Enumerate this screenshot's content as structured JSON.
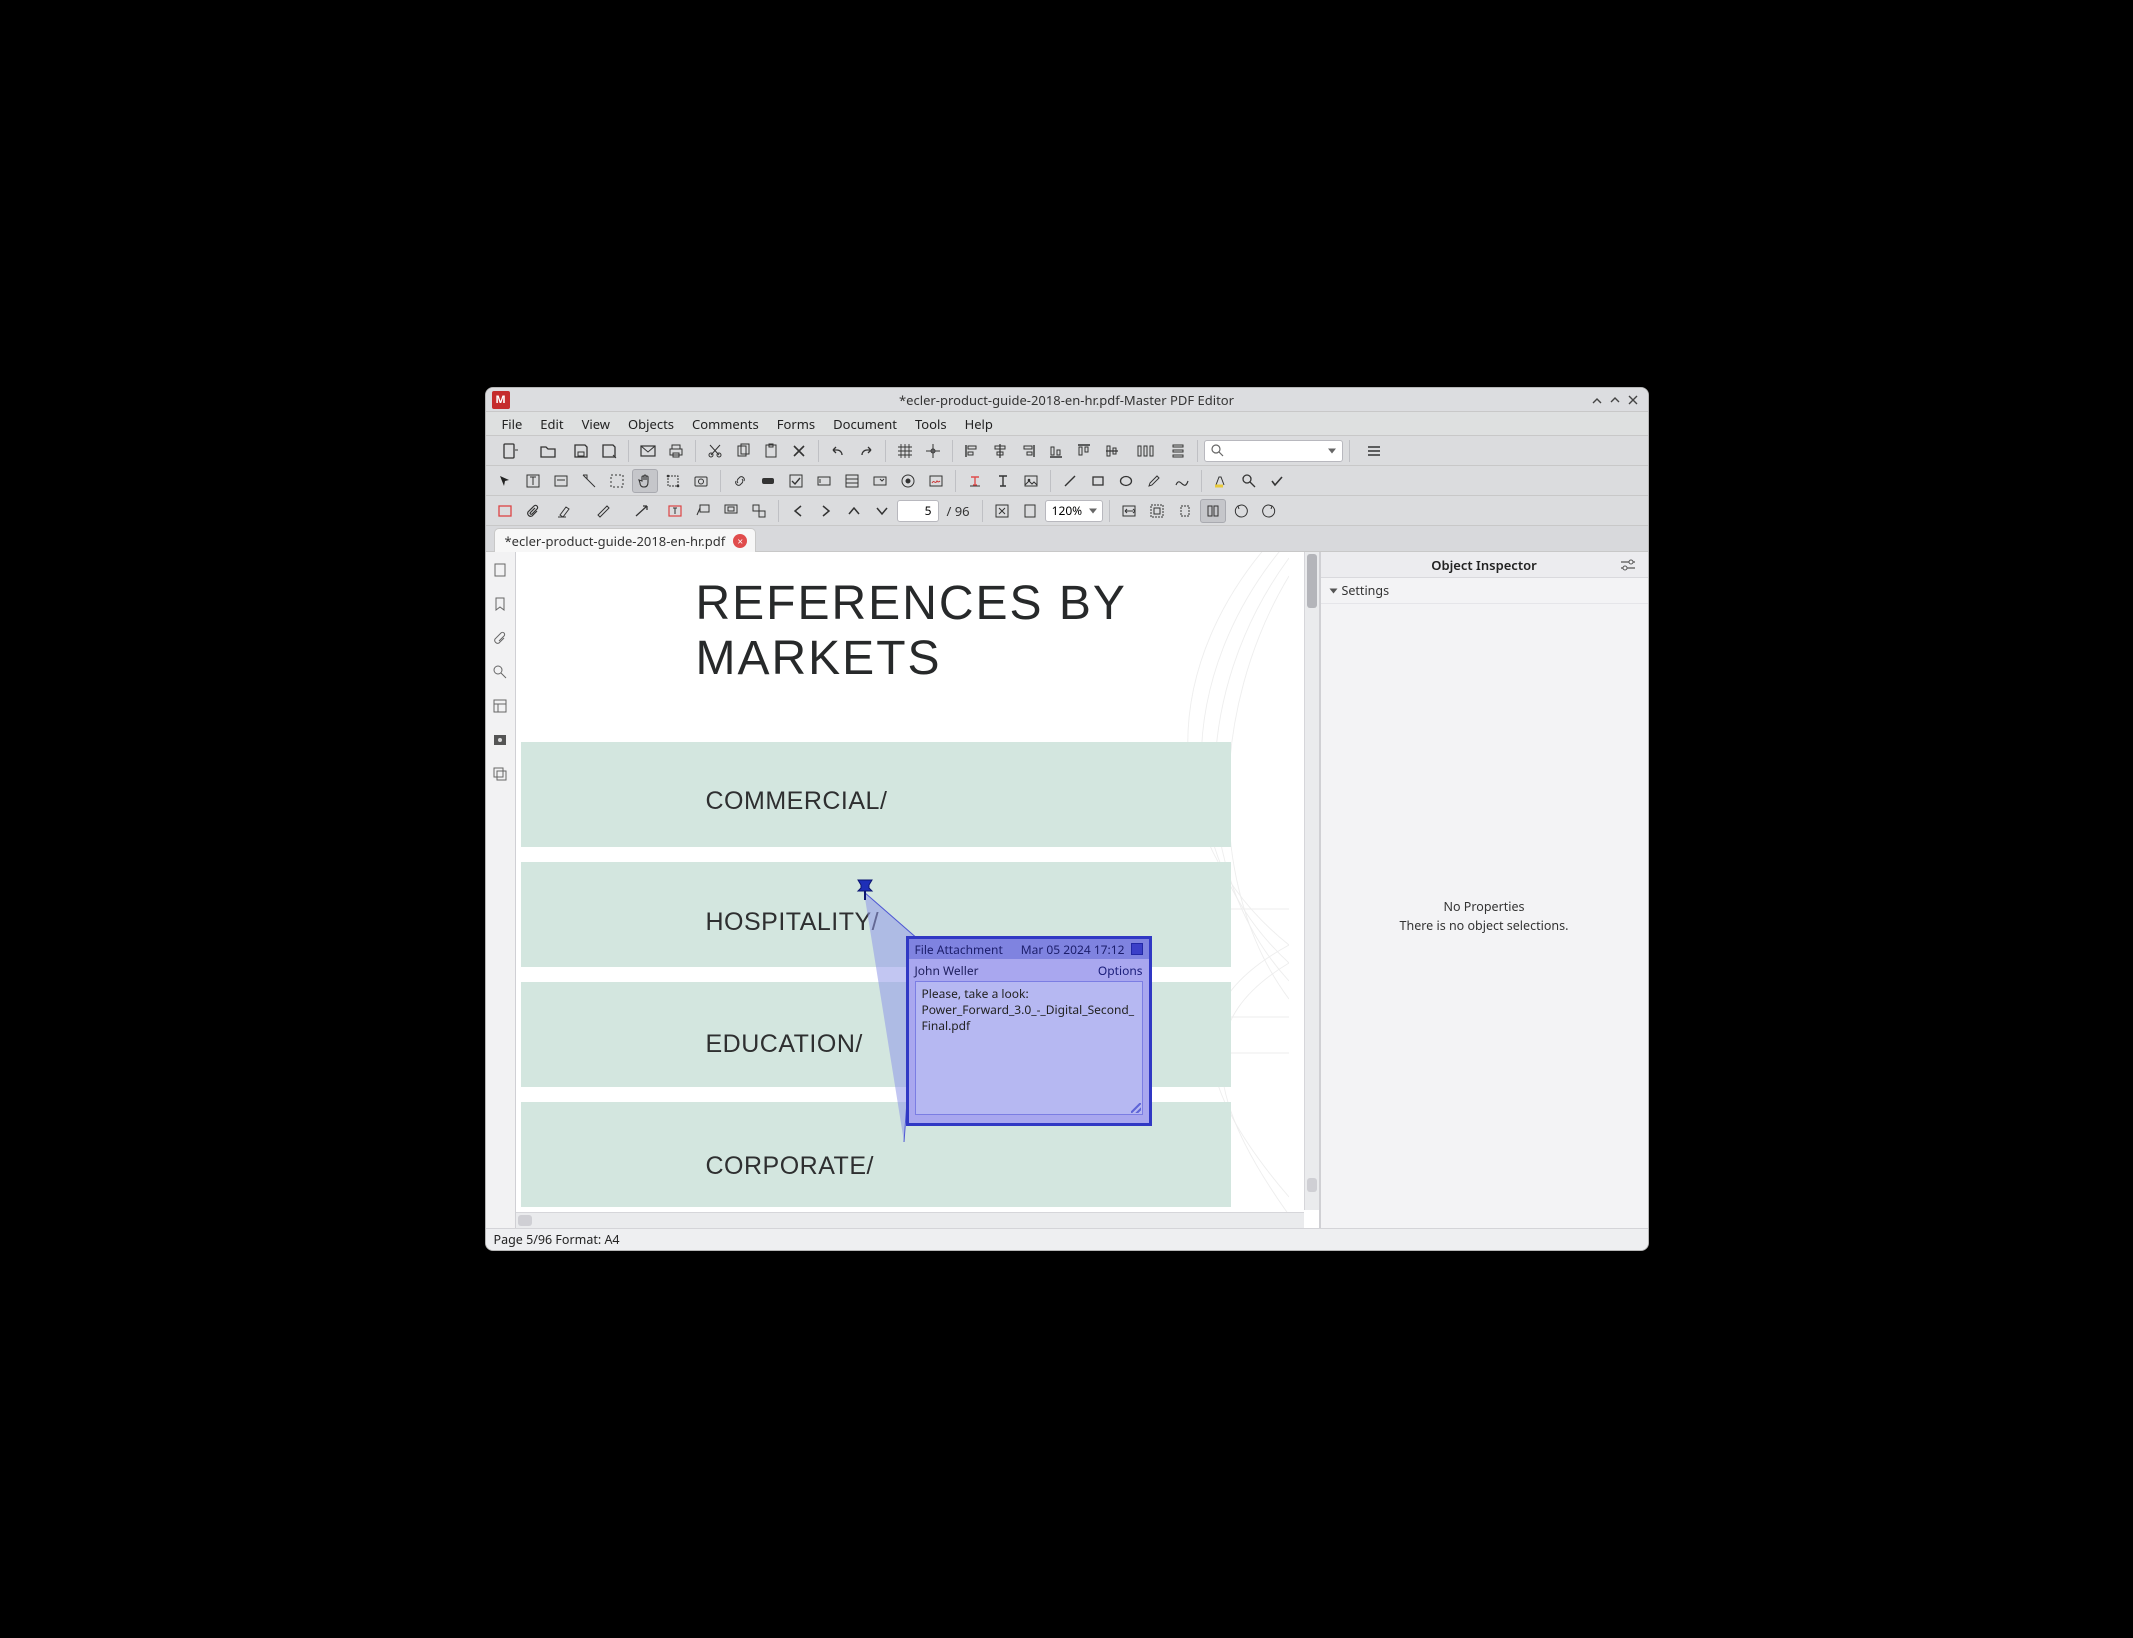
{
  "window": {
    "title": "*ecler-product-guide-2018-en-hr.pdf-Master PDF Editor"
  },
  "menu": {
    "file": "File",
    "edit": "Edit",
    "view": "View",
    "objects": "Objects",
    "comments": "Comments",
    "forms": "Forms",
    "document": "Document",
    "tools": "Tools",
    "help": "Help"
  },
  "toolbar": {
    "search_placeholder": ""
  },
  "nav": {
    "page": "5",
    "page_sep": "/ 96",
    "zoom": "120%"
  },
  "tab": {
    "name": "*ecler-product-guide-2018-en-hr.pdf"
  },
  "doc": {
    "heading": "REFERENCES BY MARKETS",
    "markets": {
      "commercial": "COMMERCIAL/",
      "hospitality": "HOSPITALITY/",
      "education": "EDUCATION/",
      "corporate": "CORPORATE/"
    }
  },
  "popup": {
    "title": "File Attachment",
    "date": "Mar 05 2024 17:12",
    "author": "John Weller",
    "options": "Options",
    "body_line1": "Please, take a look:",
    "body_line2": "Power_Forward_3.0_-_Digital_Second_Final.pdf"
  },
  "inspector": {
    "title": "Object Inspector",
    "section": "Settings",
    "noprops": "No Properties",
    "nosel": "There is no object selections."
  },
  "status": {
    "text": "Page 5/96 Format: A4"
  }
}
